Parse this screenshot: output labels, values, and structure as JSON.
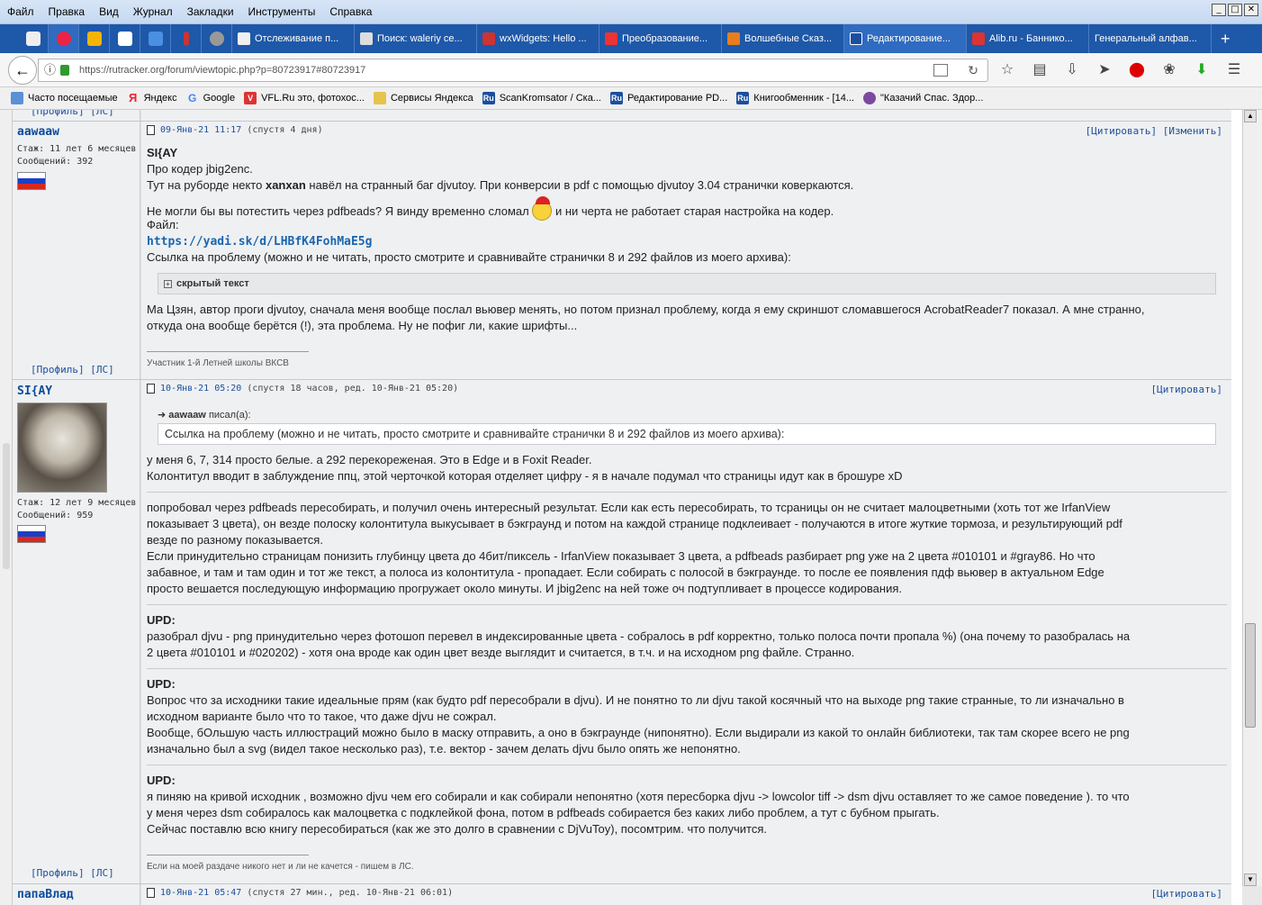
{
  "menu": [
    "Файл",
    "Правка",
    "Вид",
    "Журнал",
    "Закладки",
    "Инструменты",
    "Справка"
  ],
  "window_buttons": [
    "_",
    "□",
    "✕"
  ],
  "tabs": [
    {
      "label": "Отслеживание п...",
      "color": "#f0f0f0"
    },
    {
      "label": "Поиск: waleriy ce...",
      "color": "#ddd"
    },
    {
      "label": "wxWidgets: Hello ...",
      "color": "#c33"
    },
    {
      "label": "Преобразование...",
      "color": "#e33"
    },
    {
      "label": "Волшебные Сказ...",
      "color": "#e87d1e"
    },
    {
      "label": "Редактирование...",
      "color": "#1a4fa0"
    },
    {
      "label": "Alib.ru - Баннико...",
      "color": "#d33"
    },
    {
      "label": "Генеральный алфав...",
      "color": "#2f6bc0"
    }
  ],
  "new_tab": "+",
  "url": "https://rutracker.org/forum/viewtopic.php?p=80723917#80723917",
  "bookmarks": [
    {
      "label": "Часто посещаемые",
      "color": "#5b8fd6",
      "glyph": ""
    },
    {
      "label": "Яндекс",
      "color": "#e23",
      "glyph": "Я"
    },
    {
      "label": "Google",
      "color": "#4285f4",
      "glyph": "G"
    },
    {
      "label": "VFL.Ru это, фотохос...",
      "color": "#d33",
      "glyph": "V"
    },
    {
      "label": "Сервисы Яндекса",
      "color": "#e6c44b",
      "glyph": ""
    },
    {
      "label": "ScanKromsator / Ска...",
      "color": "#1a4fa0",
      "glyph": "Ru"
    },
    {
      "label": "Редактирование PD...",
      "color": "#1a4fa0",
      "glyph": "Ru"
    },
    {
      "label": "Книгообменник - [14...",
      "color": "#1a4fa0",
      "glyph": "Ru"
    },
    {
      "label": "\"Казачий Спас. Здор...",
      "color": "#7a4aa0",
      "glyph": ""
    }
  ],
  "posts": {
    "top_links": "[Профиль]  [ЛС]",
    "p1": {
      "author": "aawaaw",
      "stage": "Стаж: 11 лет 6 месяцев",
      "messages": "Сообщений: 392",
      "date": "09-Янв-21 11:17",
      "meta": "(спустя 4 дня)",
      "actions": "[Цитировать]  [Изменить]",
      "l1": "SI{AY",
      "l2": "Про кодер jbig2enc.",
      "l3a": "Тут на руборде некто ",
      "l3b": "xanxan",
      "l3c": " навёл на странный баг djvutoy. При конверсии в pdf с помощью djvutoy 3.04 странички коверкаются.",
      "l4a": "Не могли бы вы потестить через pdfbeads? Я винду временно сломал ",
      "l4b": " и ни черта не работает старая настройка на кодер.",
      "l5": "Файл:",
      "link": "https://yadi.sk/d/LHBfK4FohMaE5g",
      "l6": "Ссылка на проблему (можно и не читать, просто смотрите и сравнивайте странички 8 и 292 файлов из моего архива):",
      "spoiler": "скрытый текст",
      "l7": "Ма Цзян, автор проги djvutoy, сначала меня вообще послал вьювер менять, но потом признал проблему, когда я ему скриншот сломавшегося AcrobatReader7 показал. А мне странно,",
      "l8": "откуда она вообще берётся (!), эта проблема. Ну не пофиг ли, какие шрифты...",
      "sig": "Участник 1-й Летней школы ВКСВ",
      "links": "[Профиль]  [ЛС]"
    },
    "p2": {
      "author": "SI{AY",
      "stage": "Стаж: 12 лет 9 месяцев",
      "messages": "Сообщений: 959",
      "date": "10-Янв-21 05:20",
      "meta": "(спустя 18 часов, ред. 10-Янв-21 05:20)",
      "actions": "[Цитировать]",
      "quote_author": "aawaaw",
      "quote_wrote": "писал(а):",
      "quote": "Ссылка на проблему (можно и не читать, просто смотрите и сравнивайте странички 8 и 292 файлов из моего архива):",
      "a1": "у меня 6, 7, 314 просто белые. а 292 перекореженая. Это в Edge и в Foxit Reader.",
      "a2": "Колонтитул вводит в заблуждение ппц, этой черточкой которая отделяет цифру - я в начале подумал что страницы идут как в брошуре xD",
      "b1": "попробовал через pdfbeads пересобирать, и получил очень интересный результат. Если как есть пересобирать, то тсраницы он не считает малоцветными (хоть тот же IrfanView",
      "b2": "показывает 3 цвета), он везде полоску колонтитула выкусывает в бэкграунд и потом на каждой странице подклеивает - получаются в итоге жуткие тормоза, и результирующий pdf",
      "b3": "везде по разному показывается.",
      "b4": "Если принудительно страницам понизить глубинцу цвета до 4бит/пиксель - IrfanView показывает 3 цвета, а pdfbeads разбирает png уже на 2 цвета #010101 и #gray86. Но что",
      "b5": "забавное, и там и там один и тот же текст, а полоса из колонтитула - пропадает. Если собирать с полосой в бэкграунде. то после ее появления пдф вьювер в актуальном Edge",
      "b6": "просто вешается последующую информацию прогружает около минуты. И jbig2enc на ней тоже оч подтупливает в процессе кодирования.",
      "upd": "UPD:",
      "c1": "разобрал djvu - png принудительно через фотошоп перевел в индексированные цвета - собралось в pdf корректно, только полоса почти пропала %) (она почему то разобралась на",
      "c2": "2 цвета #010101 и #020202) - хотя она вроде как один цвет везде выглядит и считается, в т.ч. и на исходном png файле. Странно.",
      "d1": "Вопрос что за исходники такие идеальные прям (как будто pdf пересобрали в djvu). И не понятно то ли djvu такой косячный что на выходе png такие странные, то ли изначально в",
      "d2": "исходном варианте было что то такое, что даже djvu не сожрал.",
      "d3": "Вообще, бОльшую часть иллюстраций можно было в маску отправить, а оно в бэкграунде (нипонятно). Если выдирали из какой то онлайн библиотеки, так там скорее всего не png",
      "d4": "изначально был а svg (видел такое несколько раз), т.е. вектор - зачем делать djvu было опять же непонятно.",
      "e1": "я пиняю на кривой исходник , возможно djvu чем его собирали и как собирали непонятно (хотя пересборка djvu -> lowcolor tiff -> dsm djvu оставляет то же самое поведение ). то что",
      "e2": "у меня через dsm собиралось как малоцветка с подклейкой фона, потом в pdfbeads собирается без каких либо проблем, а тут с бубном прыгать.",
      "e3": "Сейчас поставлю всю книгу пересобираться (как же это долго в сравнении с DjVuToy), посомтрим. что получится.",
      "sig": "Если на моей раздаче никого нет и ли не качется - пишем в ЛС.",
      "links": "[Профиль]  [ЛС]"
    },
    "p3": {
      "author": "папаВлад",
      "date": "10-Янв-21 05:47",
      "meta": "(спустя 27 мин., ред. 10-Янв-21 06:01)",
      "actions": "[Цитировать]"
    }
  }
}
